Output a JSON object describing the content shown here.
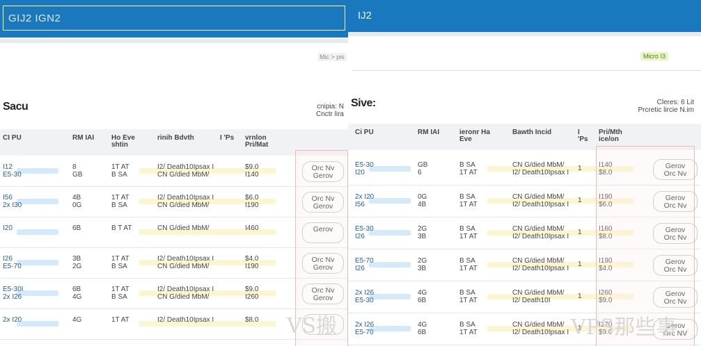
{
  "left": {
    "header_title": "GIJ2 IGN2",
    "badge": "Mic > pis",
    "section_title": "Sacu",
    "section_chip": "",
    "meta": [
      "cnipia: N",
      "Cnctr lira"
    ],
    "columns": [
      "CI PU",
      "RM IAI",
      "Ho Eve shtin",
      "rinih Bdvth",
      "I 'Ps",
      "vrnlon Pri/Mat"
    ],
    "rows": [
      {
        "cpu": [
          "I12",
          "E5-30"
        ],
        "ram": [
          "8",
          "GB"
        ],
        "disk": [
          "1T AT",
          "B SA"
        ],
        "bw": [
          "I2/ Death10Ipsax I",
          "CN G/died MbM/"
        ],
        "ip": "",
        "price": [
          "$9.0",
          "I140"
        ],
        "btn": [
          "Orc Nv",
          "Gerov"
        ]
      },
      {
        "cpu": [
          "I56",
          "2x I30"
        ],
        "ram": [
          "4B",
          "0G"
        ],
        "disk": [
          "1T AT",
          "B SA"
        ],
        "bw": [
          "I2/ Death10Ipsax I",
          "CN G/died MbM/"
        ],
        "ip": "",
        "price": [
          "$6.0",
          "I190"
        ],
        "btn": [
          "Orc Nv",
          "Gerov"
        ]
      },
      {
        "cpu": [
          "I20",
          ""
        ],
        "ram": [
          "6B",
          ""
        ],
        "disk": [
          "B T AT",
          ""
        ],
        "bw": [
          "CN G/died MbM/",
          ""
        ],
        "ip": "",
        "price": [
          "I460",
          ""
        ],
        "btn": [
          "Gerov",
          ""
        ]
      },
      {
        "cpu": [
          "I26",
          "E5-70"
        ],
        "ram": [
          "3B",
          "2G"
        ],
        "disk": [
          "1T AT",
          "B SA"
        ],
        "bw": [
          "I2/ Death10Ipsax I",
          "CN G/died MbM/"
        ],
        "ip": "",
        "price": [
          "$4.0",
          "I190"
        ],
        "btn": [
          "Orc Nv",
          "Gerov"
        ]
      },
      {
        "cpu": [
          "E5-30I",
          "2x I26"
        ],
        "ram": [
          "6B",
          "4G"
        ],
        "disk": [
          "1T AT",
          "B SA"
        ],
        "bw": [
          "I2/ Death10Ipsax I",
          "CN G/died MbM/"
        ],
        "ip": "",
        "price": [
          "$9.0",
          "I260"
        ],
        "btn": [
          "Orc Nv",
          "Gerov"
        ]
      },
      {
        "cpu": [
          "2x I20",
          ""
        ],
        "ram": [
          "4G",
          ""
        ],
        "disk": [
          "1T AT",
          ""
        ],
        "bw": [
          "I2/ Death10Ipsax I",
          ""
        ],
        "ip": "",
        "price": [
          "$8.0",
          ""
        ],
        "btn": [
          "",
          ""
        ]
      }
    ],
    "watermark": "VS搬"
  },
  "right": {
    "header_title": "IJ2",
    "chip": "Micro I3",
    "section_title": "Sive:",
    "meta": [
      "Cleres: 6 Lit",
      "Prcretic lircie N.im"
    ],
    "columns": [
      "Ci PU",
      "RM IAI",
      "ieronr Ha Eve",
      "Bawth Incid",
      "I 'Ps",
      "Pri/Mth ice/on"
    ],
    "rows": [
      {
        "cpu": [
          "E5-30",
          "I20"
        ],
        "ram": [
          "GB",
          "6"
        ],
        "disk": [
          "B SA",
          "1T AT"
        ],
        "bw": [
          "CN G/died MbM/",
          "I2/ Death10Ipsax I"
        ],
        "ip": "1",
        "price": [
          "I140",
          "$8.0"
        ],
        "btn": [
          "Gerov",
          "Orc Nv"
        ]
      },
      {
        "cpu": [
          "2x I20",
          "I56"
        ],
        "ram": [
          "0G",
          "4B"
        ],
        "disk": [
          "B SA",
          "1T AT"
        ],
        "bw": [
          "CN G/died MbM/",
          "I2/ Death10Ipsax I"
        ],
        "ip": "1",
        "price": [
          "I190",
          "$6.0"
        ],
        "btn": [
          "Gerov",
          "Orc Nv"
        ]
      },
      {
        "cpu": [
          "E5-30",
          "I26"
        ],
        "ram": [
          "2G",
          "3B"
        ],
        "disk": [
          "B SA",
          "1T AT"
        ],
        "bw": [
          "CN G/died MbM/",
          "I2/ Death10Ipsax I"
        ],
        "ip": "1",
        "price": [
          "I160",
          "$8.0"
        ],
        "btn": [
          "Gerov",
          "Orc Nv"
        ]
      },
      {
        "cpu": [
          "E5-70",
          "I26"
        ],
        "ram": [
          "2G",
          "3B"
        ],
        "disk": [
          "B SA",
          "1T AT"
        ],
        "bw": [
          "CN G/died MbM/",
          "I2/ Death10Ipsax I"
        ],
        "ip": "1",
        "price": [
          "I190",
          "$4.0"
        ],
        "btn": [
          "Gerov",
          "Orc Nv"
        ]
      },
      {
        "cpu": [
          "2x I26",
          "E5-30"
        ],
        "ram": [
          "4G",
          "6B"
        ],
        "disk": [
          "B SA",
          "1T AT"
        ],
        "bw": [
          "CN G/died MbM/",
          "I2/ Death10I"
        ],
        "ip": "1",
        "price": [
          "I260",
          "$9.0"
        ],
        "btn": [
          "Gerov",
          "Orc Nv"
        ]
      },
      {
        "cpu": [
          "2x I26",
          "E5-70"
        ],
        "ram": [
          "4G",
          "6B"
        ],
        "disk": [
          "B SA",
          "1T AT"
        ],
        "bw": [
          "CN G/died MbM/",
          "I2/ Death10Ipsax I"
        ],
        "ip": "1",
        "price": [
          "I270",
          "$9.0"
        ],
        "btn": [
          "Gerov",
          "Orc NV"
        ]
      }
    ],
    "watermark": "VPS那些事"
  },
  "colors": {
    "header_blue": "#1a78be",
    "chip_green": "#e8f6c7",
    "row_highlight_blue": "#cfe8fb",
    "row_highlight_yellow": "#fbf5c8",
    "redbox": "#f0b9b9"
  }
}
